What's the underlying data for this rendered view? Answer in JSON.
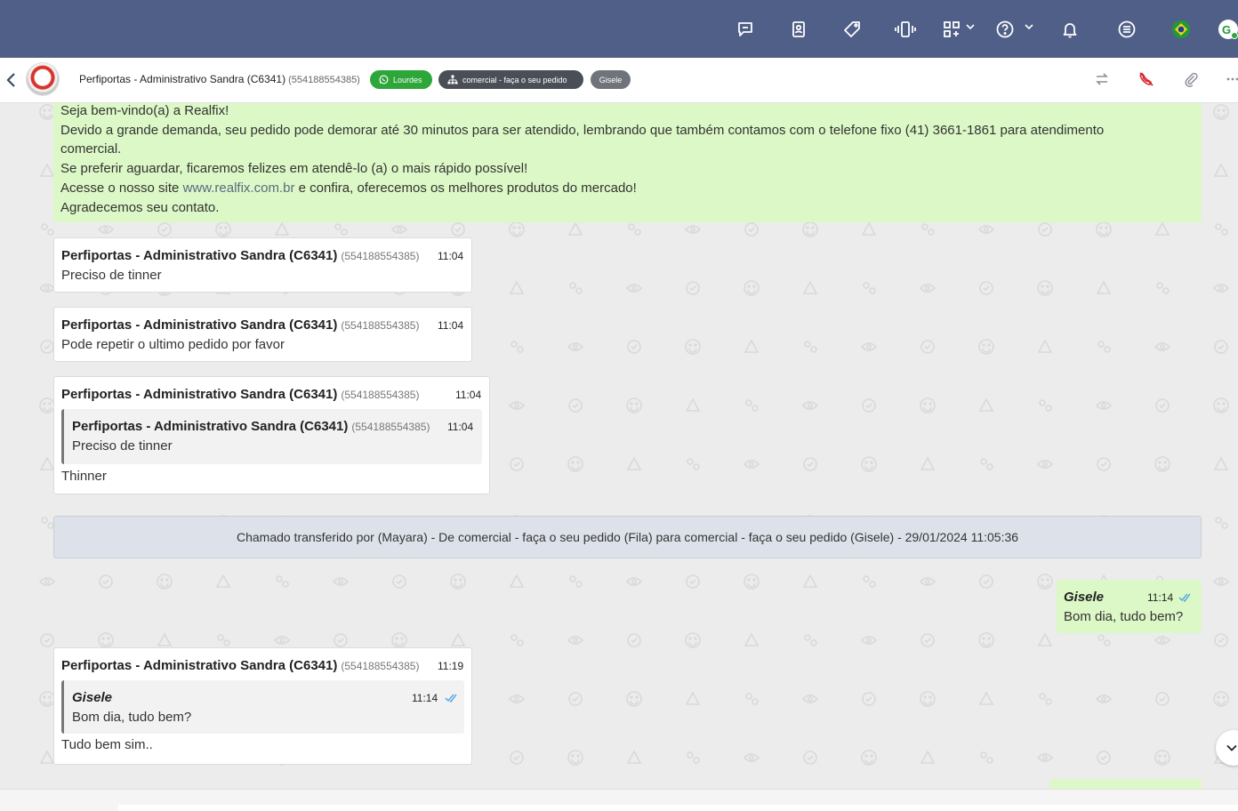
{
  "header": {
    "icons": [
      "chat-bubble-icon",
      "contacts-book-icon",
      "tag-icon",
      "vibrate-icon",
      "apps-grid-icon",
      "help-icon",
      "bell-icon",
      "menu-list-icon",
      "brazil-flag-icon",
      "user-avatar-icon"
    ]
  },
  "conversation": {
    "contact_name": "Perfiportas - Administrativo Sandra (C6341)",
    "contact_phone": "(554188554385)",
    "tags": {
      "whatsapp": "Lourdes",
      "queue": "comercial - faça o seu pedido",
      "agent": "Gisele"
    },
    "actions": [
      "transfer-icon",
      "end-call-icon",
      "attach-icon",
      "more-icon"
    ]
  },
  "welcome": {
    "line1": "Seja bem-vindo(a) a Realfix!",
    "line2": "Devido a grande demanda, seu pedido pode demorar até 30 minutos para ser atendido, lembrando que também contamos com o telefone fixo (41) 3661-1861 para atendimento",
    "line3": "comercial.",
    "line4": "Se preferir aguardar, ficaremos felizes em atendê-lo (a) o mais rápido possível!",
    "line5_pre": "Acesse o nosso site ",
    "line5_link": "www.realfix.com.br",
    "line5_post": " e confira, oferecemos os melhores produtos do mercado!",
    "line6": "Agradecemos seu contato."
  },
  "messages": [
    {
      "sender": "Perfiportas - Administrativo Sandra (C6341)",
      "phone": "(554188554385)",
      "time": "11:04",
      "text": "Preciso de tinner"
    },
    {
      "sender": "Perfiportas - Administrativo Sandra (C6341)",
      "phone": "(554188554385)",
      "time": "11:04",
      "text": "Pode repetir o ultimo pedido por favor"
    },
    {
      "sender": "Perfiportas - Administrativo Sandra (C6341)",
      "phone": "(554188554385)",
      "time": "11:04",
      "text": "Thinner",
      "quote": {
        "sender": "Perfiportas - Administrativo Sandra (C6341)",
        "phone": "(554188554385)",
        "time": "11:04",
        "text": "Preciso de tinner"
      }
    },
    {
      "sender": "Perfiportas - Administrativo Sandra (C6341)",
      "phone": "(554188554385)",
      "time": "11:19",
      "text": "Tudo bem sim..",
      "quote": {
        "sender": "Gisele",
        "time": "11:14",
        "text": "Bom dia, tudo bem?"
      }
    }
  ],
  "system_message": "Chamado transferido por (Mayara) - De comercial - faça o seu pedido (Fila) para comercial - faça o seu pedido (Gisele) - 29/01/2024 11:05:36",
  "outgoing": {
    "sender": "Gisele",
    "time": "11:14",
    "text": "Bom dia, tudo bem?"
  },
  "colors": {
    "topbar": "#4f5f87",
    "incoming": "#ffffff",
    "outgoing": "#dcf8c6",
    "system": "#dde2ea",
    "tag_green": "#2da63a",
    "tick_blue": "#4fa3e0"
  }
}
